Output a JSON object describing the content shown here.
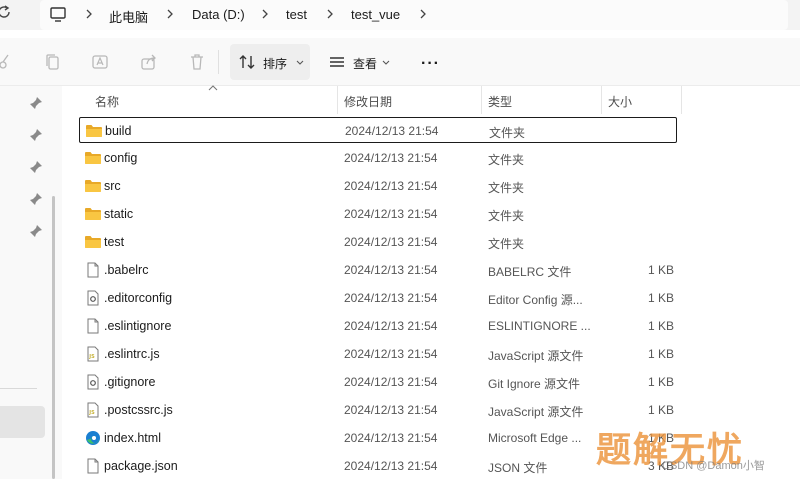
{
  "breadcrumb": {
    "items": [
      "此电脑",
      "Data (D:)",
      "test",
      "test_vue"
    ]
  },
  "toolbar": {
    "sort_label": "排序",
    "view_label": "查看",
    "more_label": "···"
  },
  "columns": {
    "name": "名称",
    "modified": "修改日期",
    "type": "类型",
    "size": "大小"
  },
  "files": [
    {
      "name": "build",
      "date": "2024/12/13 21:54",
      "type": "文件夹",
      "size": "",
      "icon": "folder-icon",
      "selected": true
    },
    {
      "name": "config",
      "date": "2024/12/13 21:54",
      "type": "文件夹",
      "size": "",
      "icon": "folder-icon"
    },
    {
      "name": "src",
      "date": "2024/12/13 21:54",
      "type": "文件夹",
      "size": "",
      "icon": "folder-icon"
    },
    {
      "name": "static",
      "date": "2024/12/13 21:54",
      "type": "文件夹",
      "size": "",
      "icon": "folder-icon"
    },
    {
      "name": "test",
      "date": "2024/12/13 21:54",
      "type": "文件夹",
      "size": "",
      "icon": "folder-icon"
    },
    {
      "name": ".babelrc",
      "date": "2024/12/13 21:54",
      "type": "BABELRC 文件",
      "size": "1 KB",
      "icon": "file-icon"
    },
    {
      "name": ".editorconfig",
      "date": "2024/12/13 21:54",
      "type": "Editor Config 源...",
      "size": "1 KB",
      "icon": "config-file-icon"
    },
    {
      "name": ".eslintignore",
      "date": "2024/12/13 21:54",
      "type": "ESLINTIGNORE ...",
      "size": "1 KB",
      "icon": "file-icon"
    },
    {
      "name": ".eslintrc.js",
      "date": "2024/12/13 21:54",
      "type": "JavaScript 源文件",
      "size": "1 KB",
      "icon": "js-file-icon"
    },
    {
      "name": ".gitignore",
      "date": "2024/12/13 21:54",
      "type": "Git Ignore 源文件",
      "size": "1 KB",
      "icon": "config-file-icon"
    },
    {
      "name": ".postcssrc.js",
      "date": "2024/12/13 21:54",
      "type": "JavaScript 源文件",
      "size": "1 KB",
      "icon": "js-file-icon"
    },
    {
      "name": "index.html",
      "date": "2024/12/13 21:54",
      "type": "Microsoft Edge ...",
      "size": "1 KB",
      "icon": "edge-html-icon"
    },
    {
      "name": "package.json",
      "date": "2024/12/13 21:54",
      "type": "JSON 文件",
      "size": "3 KB",
      "icon": "file-icon"
    }
  ],
  "watermark": {
    "text": "题解无忧",
    "credit": "CSDN @Damon小智"
  },
  "colors": {
    "folder": "#f9c642",
    "folder_tab": "#e8a928",
    "js_badge": "#c8b43c",
    "edge_blue": "#1a7fd1",
    "edge_green": "#3ec26a",
    "watermark": "#ec943c"
  }
}
